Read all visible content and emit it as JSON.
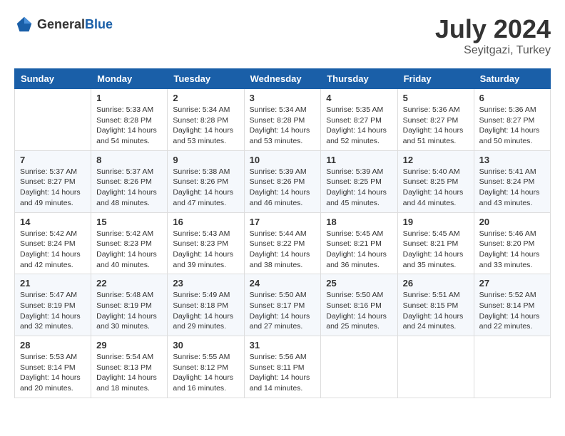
{
  "header": {
    "logo_general": "General",
    "logo_blue": "Blue",
    "month": "July 2024",
    "location": "Seyitgazi, Turkey"
  },
  "weekdays": [
    "Sunday",
    "Monday",
    "Tuesday",
    "Wednesday",
    "Thursday",
    "Friday",
    "Saturday"
  ],
  "weeks": [
    [
      {
        "day": "",
        "sunrise": "",
        "sunset": "",
        "daylight": ""
      },
      {
        "day": "1",
        "sunrise": "Sunrise: 5:33 AM",
        "sunset": "Sunset: 8:28 PM",
        "daylight": "Daylight: 14 hours and 54 minutes."
      },
      {
        "day": "2",
        "sunrise": "Sunrise: 5:34 AM",
        "sunset": "Sunset: 8:28 PM",
        "daylight": "Daylight: 14 hours and 53 minutes."
      },
      {
        "day": "3",
        "sunrise": "Sunrise: 5:34 AM",
        "sunset": "Sunset: 8:28 PM",
        "daylight": "Daylight: 14 hours and 53 minutes."
      },
      {
        "day": "4",
        "sunrise": "Sunrise: 5:35 AM",
        "sunset": "Sunset: 8:27 PM",
        "daylight": "Daylight: 14 hours and 52 minutes."
      },
      {
        "day": "5",
        "sunrise": "Sunrise: 5:36 AM",
        "sunset": "Sunset: 8:27 PM",
        "daylight": "Daylight: 14 hours and 51 minutes."
      },
      {
        "day": "6",
        "sunrise": "Sunrise: 5:36 AM",
        "sunset": "Sunset: 8:27 PM",
        "daylight": "Daylight: 14 hours and 50 minutes."
      }
    ],
    [
      {
        "day": "7",
        "sunrise": "Sunrise: 5:37 AM",
        "sunset": "Sunset: 8:27 PM",
        "daylight": "Daylight: 14 hours and 49 minutes."
      },
      {
        "day": "8",
        "sunrise": "Sunrise: 5:37 AM",
        "sunset": "Sunset: 8:26 PM",
        "daylight": "Daylight: 14 hours and 48 minutes."
      },
      {
        "day": "9",
        "sunrise": "Sunrise: 5:38 AM",
        "sunset": "Sunset: 8:26 PM",
        "daylight": "Daylight: 14 hours and 47 minutes."
      },
      {
        "day": "10",
        "sunrise": "Sunrise: 5:39 AM",
        "sunset": "Sunset: 8:26 PM",
        "daylight": "Daylight: 14 hours and 46 minutes."
      },
      {
        "day": "11",
        "sunrise": "Sunrise: 5:39 AM",
        "sunset": "Sunset: 8:25 PM",
        "daylight": "Daylight: 14 hours and 45 minutes."
      },
      {
        "day": "12",
        "sunrise": "Sunrise: 5:40 AM",
        "sunset": "Sunset: 8:25 PM",
        "daylight": "Daylight: 14 hours and 44 minutes."
      },
      {
        "day": "13",
        "sunrise": "Sunrise: 5:41 AM",
        "sunset": "Sunset: 8:24 PM",
        "daylight": "Daylight: 14 hours and 43 minutes."
      }
    ],
    [
      {
        "day": "14",
        "sunrise": "Sunrise: 5:42 AM",
        "sunset": "Sunset: 8:24 PM",
        "daylight": "Daylight: 14 hours and 42 minutes."
      },
      {
        "day": "15",
        "sunrise": "Sunrise: 5:42 AM",
        "sunset": "Sunset: 8:23 PM",
        "daylight": "Daylight: 14 hours and 40 minutes."
      },
      {
        "day": "16",
        "sunrise": "Sunrise: 5:43 AM",
        "sunset": "Sunset: 8:23 PM",
        "daylight": "Daylight: 14 hours and 39 minutes."
      },
      {
        "day": "17",
        "sunrise": "Sunrise: 5:44 AM",
        "sunset": "Sunset: 8:22 PM",
        "daylight": "Daylight: 14 hours and 38 minutes."
      },
      {
        "day": "18",
        "sunrise": "Sunrise: 5:45 AM",
        "sunset": "Sunset: 8:21 PM",
        "daylight": "Daylight: 14 hours and 36 minutes."
      },
      {
        "day": "19",
        "sunrise": "Sunrise: 5:45 AM",
        "sunset": "Sunset: 8:21 PM",
        "daylight": "Daylight: 14 hours and 35 minutes."
      },
      {
        "day": "20",
        "sunrise": "Sunrise: 5:46 AM",
        "sunset": "Sunset: 8:20 PM",
        "daylight": "Daylight: 14 hours and 33 minutes."
      }
    ],
    [
      {
        "day": "21",
        "sunrise": "Sunrise: 5:47 AM",
        "sunset": "Sunset: 8:19 PM",
        "daylight": "Daylight: 14 hours and 32 minutes."
      },
      {
        "day": "22",
        "sunrise": "Sunrise: 5:48 AM",
        "sunset": "Sunset: 8:19 PM",
        "daylight": "Daylight: 14 hours and 30 minutes."
      },
      {
        "day": "23",
        "sunrise": "Sunrise: 5:49 AM",
        "sunset": "Sunset: 8:18 PM",
        "daylight": "Daylight: 14 hours and 29 minutes."
      },
      {
        "day": "24",
        "sunrise": "Sunrise: 5:50 AM",
        "sunset": "Sunset: 8:17 PM",
        "daylight": "Daylight: 14 hours and 27 minutes."
      },
      {
        "day": "25",
        "sunrise": "Sunrise: 5:50 AM",
        "sunset": "Sunset: 8:16 PM",
        "daylight": "Daylight: 14 hours and 25 minutes."
      },
      {
        "day": "26",
        "sunrise": "Sunrise: 5:51 AM",
        "sunset": "Sunset: 8:15 PM",
        "daylight": "Daylight: 14 hours and 24 minutes."
      },
      {
        "day": "27",
        "sunrise": "Sunrise: 5:52 AM",
        "sunset": "Sunset: 8:14 PM",
        "daylight": "Daylight: 14 hours and 22 minutes."
      }
    ],
    [
      {
        "day": "28",
        "sunrise": "Sunrise: 5:53 AM",
        "sunset": "Sunset: 8:14 PM",
        "daylight": "Daylight: 14 hours and 20 minutes."
      },
      {
        "day": "29",
        "sunrise": "Sunrise: 5:54 AM",
        "sunset": "Sunset: 8:13 PM",
        "daylight": "Daylight: 14 hours and 18 minutes."
      },
      {
        "day": "30",
        "sunrise": "Sunrise: 5:55 AM",
        "sunset": "Sunset: 8:12 PM",
        "daylight": "Daylight: 14 hours and 16 minutes."
      },
      {
        "day": "31",
        "sunrise": "Sunrise: 5:56 AM",
        "sunset": "Sunset: 8:11 PM",
        "daylight": "Daylight: 14 hours and 14 minutes."
      },
      {
        "day": "",
        "sunrise": "",
        "sunset": "",
        "daylight": ""
      },
      {
        "day": "",
        "sunrise": "",
        "sunset": "",
        "daylight": ""
      },
      {
        "day": "",
        "sunrise": "",
        "sunset": "",
        "daylight": ""
      }
    ]
  ]
}
